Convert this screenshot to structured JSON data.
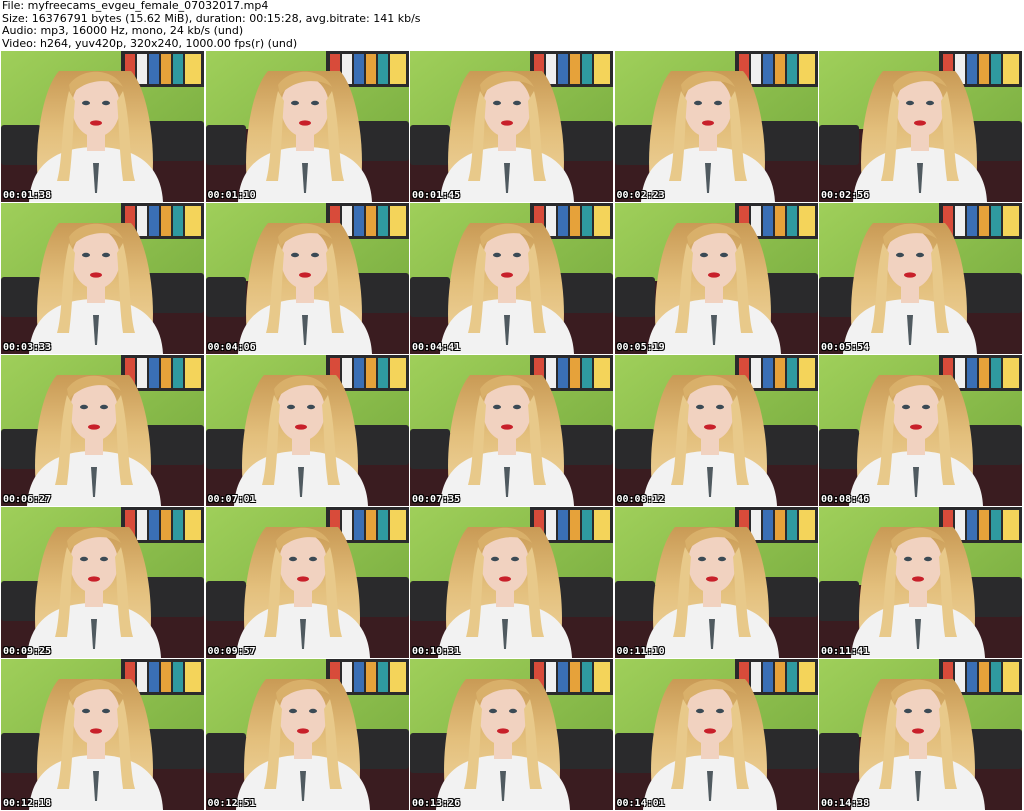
{
  "header": {
    "file_line": "File: myfreecams_evgeu_female_07032017.mp4",
    "size_line": "Size: 16376791 bytes (15.62 MiB), duration: 00:15:28, avg.bitrate: 141 kb/s",
    "audio_line": "Audio: mp3, 16000 Hz, mono, 24 kb/s (und)",
    "video_line": "Video: h264, yuv420p, 320x240, 1000.00 fps(r) (und)"
  },
  "thumbnails": [
    {
      "time": "00:01:38"
    },
    {
      "time": "00:01:10"
    },
    {
      "time": "00:01:45"
    },
    {
      "time": "00:02:23"
    },
    {
      "time": "00:02:56"
    },
    {
      "time": "00:03:33"
    },
    {
      "time": "00:04:06"
    },
    {
      "time": "00:04:41"
    },
    {
      "time": "00:05:19"
    },
    {
      "time": "00:05:54"
    },
    {
      "time": "00:06:27"
    },
    {
      "time": "00:07:01"
    },
    {
      "time": "00:07:35"
    },
    {
      "time": "00:08:12"
    },
    {
      "time": "00:08:46"
    },
    {
      "time": "00:09:25"
    },
    {
      "time": "00:09:57"
    },
    {
      "time": "00:10:31"
    },
    {
      "time": "00:11:10"
    },
    {
      "time": "00:11:41"
    },
    {
      "time": "00:12:18"
    },
    {
      "time": "00:12:51"
    },
    {
      "time": "00:13:26"
    },
    {
      "time": "00:14:01"
    },
    {
      "time": "00:14:38"
    }
  ],
  "colors": {
    "wall": "#8cc04a",
    "wall_dark": "#6fa23a",
    "couch": "#3a1c20",
    "couch_cushion": "#2a2a2c",
    "hair": "#d9b06a",
    "hair_light": "#e8c98a",
    "skin": "#f1d2c0",
    "shirt": "#f2f2f2",
    "lips": "#c8202a",
    "jeans": "#3b5b8c"
  }
}
